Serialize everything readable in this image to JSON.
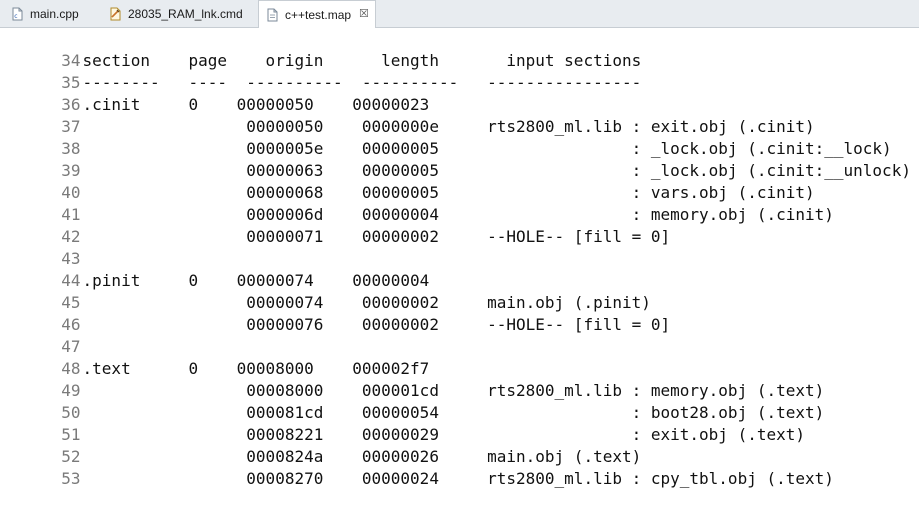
{
  "tabs": [
    {
      "label": "main.cpp",
      "icon": "cpp-file-icon"
    },
    {
      "label": "28035_RAM_lnk.cmd",
      "icon": "cmd-file-icon"
    },
    {
      "label": "c++test.map",
      "icon": "map-file-icon",
      "active": true,
      "close": "☒"
    }
  ],
  "editor": {
    "lines": [
      {
        "num": "34",
        "text": "section    page    origin      length       input sections"
      },
      {
        "num": "35",
        "text": "--------   ----  ----------  ----------   ----------------"
      },
      {
        "num": "36",
        "text": ".cinit     0    00000050    00000023"
      },
      {
        "num": "37",
        "text": "                 00000050    0000000e     rts2800_ml.lib : exit.obj (.cinit)"
      },
      {
        "num": "38",
        "text": "                 0000005e    00000005                    : _lock.obj (.cinit:__lock)"
      },
      {
        "num": "39",
        "text": "                 00000063    00000005                    : _lock.obj (.cinit:__unlock)"
      },
      {
        "num": "40",
        "text": "                 00000068    00000005                    : vars.obj (.cinit)"
      },
      {
        "num": "41",
        "text": "                 0000006d    00000004                    : memory.obj (.cinit)"
      },
      {
        "num": "42",
        "text": "                 00000071    00000002     --HOLE-- [fill = 0]"
      },
      {
        "num": "43",
        "text": ""
      },
      {
        "num": "44",
        "text": ".pinit     0    00000074    00000004"
      },
      {
        "num": "45",
        "text": "                 00000074    00000002     main.obj (.pinit)"
      },
      {
        "num": "46",
        "text": "                 00000076    00000002     --HOLE-- [fill = 0]"
      },
      {
        "num": "47",
        "text": ""
      },
      {
        "num": "48",
        "text": ".text      0    00008000    000002f7"
      },
      {
        "num": "49",
        "text": "                 00008000    000001cd     rts2800_ml.lib : memory.obj (.text)"
      },
      {
        "num": "50",
        "text": "                 000081cd    00000054                    : boot28.obj (.text)"
      },
      {
        "num": "51",
        "text": "                 00008221    00000029                    : exit.obj (.text)"
      },
      {
        "num": "52",
        "text": "                 0000824a    00000026     main.obj (.text)"
      },
      {
        "num": "53",
        "text": "                 00008270    00000024     rts2800_ml.lib : cpy_tbl.obj (.text)"
      }
    ]
  }
}
